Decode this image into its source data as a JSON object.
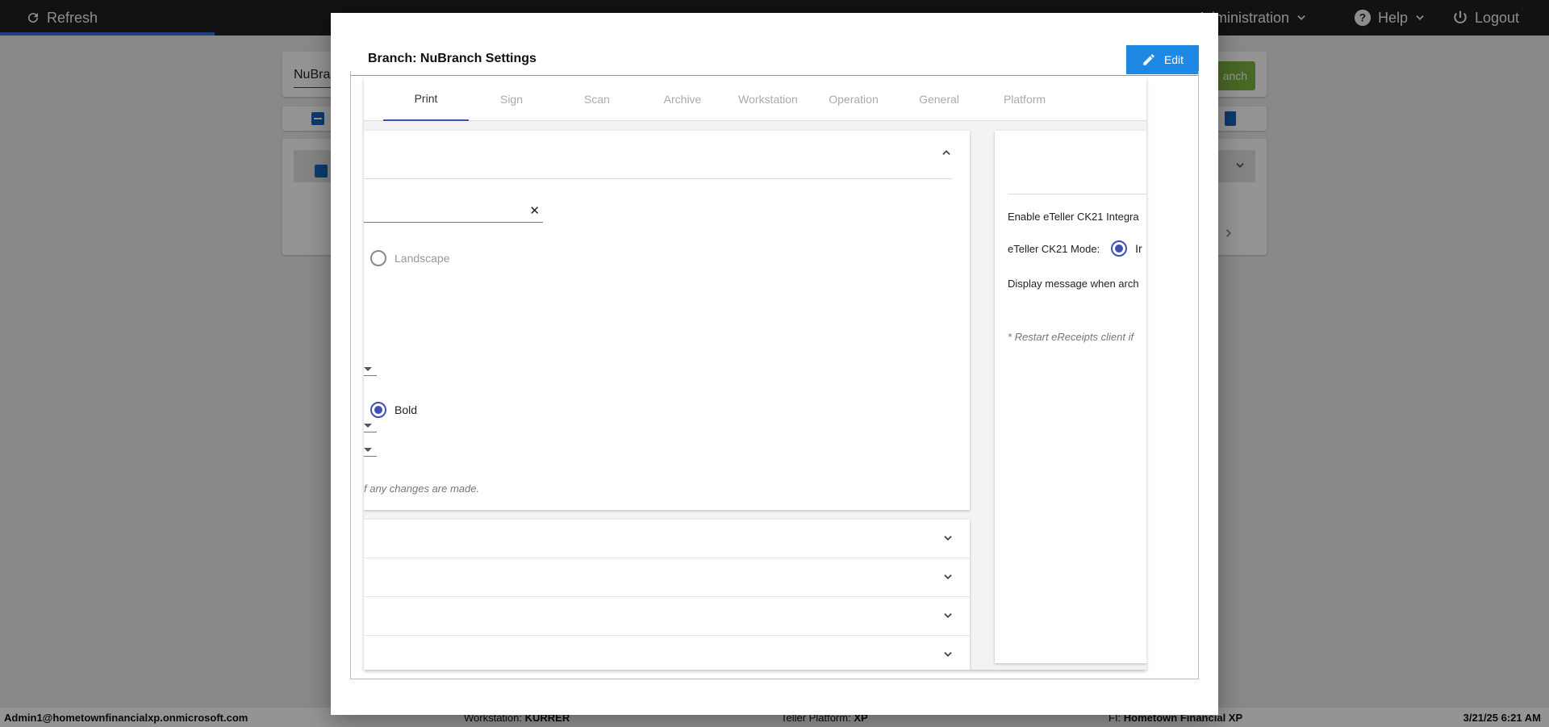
{
  "topbar": {
    "refresh_label": "Refresh",
    "admin_label": "Administration",
    "help_label": "Help",
    "logout_label": "Logout"
  },
  "background": {
    "search_value": "NuBra",
    "add_button_label": "anch"
  },
  "footer": {
    "user": "Admin1@hometownfinancialxp.onmicrosoft.com",
    "workstation_label": "Workstation: ",
    "workstation_value": "KURRER",
    "teller_label": "Teller Platform: ",
    "teller_value": "XP",
    "fi_label": "FI: ",
    "fi_value": "Hometown Financial XP",
    "datetime": "3/21/25 6:21 AM"
  },
  "modal": {
    "title": "Branch: NuBranch Settings",
    "edit_label": "Edit",
    "tabs": [
      {
        "label": "Print",
        "active": true
      },
      {
        "label": "Sign"
      },
      {
        "label": "Scan"
      },
      {
        "label": "Archive"
      },
      {
        "label": "Workstation"
      },
      {
        "label": "Operation"
      },
      {
        "label": "General"
      },
      {
        "label": "Platform"
      }
    ],
    "print": {
      "landscape_label": "Landscape",
      "bold_label": "Bold",
      "note": "f any changes are made."
    },
    "right": {
      "enable_label": "Enable eTeller CK21 Integra",
      "mode_label": "eTeller CK21 Mode:",
      "mode_value": "Ir",
      "display_label": "Display message when arch",
      "restart_note": "* Restart eReceipts client if"
    }
  },
  "colors": {
    "accent": "#3f51b5",
    "edit_button": "#1e88e5",
    "add_button": "#7cb342",
    "topbar": "#1f1f1f"
  }
}
